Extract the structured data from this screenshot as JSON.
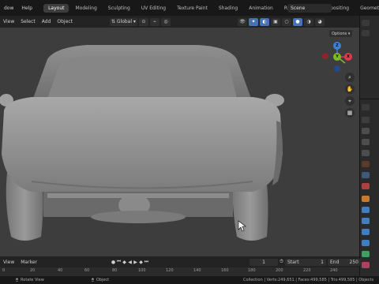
{
  "topbar": {
    "menus": [
      "dow",
      "Help"
    ],
    "workspaces": [
      {
        "label": "Layout",
        "active": true
      },
      {
        "label": "Modeling",
        "active": false
      },
      {
        "label": "Sculpting",
        "active": false
      },
      {
        "label": "UV Editing",
        "active": false
      },
      {
        "label": "Texture Paint",
        "active": false
      },
      {
        "label": "Shading",
        "active": false
      },
      {
        "label": "Animation",
        "active": false
      },
      {
        "label": "Rendering",
        "active": false
      },
      {
        "label": "Compositing",
        "active": false
      },
      {
        "label": "Geometry N",
        "active": false
      }
    ],
    "scene": "Scene"
  },
  "viewport_header": {
    "menus": [
      "View",
      "Select",
      "Add",
      "Object"
    ],
    "orientation": "Global",
    "options": "Options"
  },
  "timeline": {
    "menus": [
      "View",
      "Marker"
    ],
    "current_frame": "1",
    "start_label": "Start",
    "start_value": "1",
    "end_label": "End",
    "end_value": "250"
  },
  "ruler": {
    "ticks": [
      "0",
      "20",
      "40",
      "60",
      "80",
      "100",
      "120",
      "140",
      "160",
      "180",
      "200",
      "220",
      "240"
    ]
  },
  "statusbar": {
    "left_action": "Rotate View",
    "mid_action": "Object",
    "stats": "Collection | Verts:249,651 | Faces:499,585 | Tris:499,585 | Objects"
  },
  "gizmo": {
    "x": "X",
    "y": "Y",
    "z": "Z",
    "colors": {
      "x": "#e0394c",
      "y": "#7dba2a",
      "z": "#3d7fe0"
    }
  },
  "theme": {
    "accent": "#4772b3",
    "viewport_bg": "#3d3d3d",
    "car_body": "#9a9a9a"
  }
}
